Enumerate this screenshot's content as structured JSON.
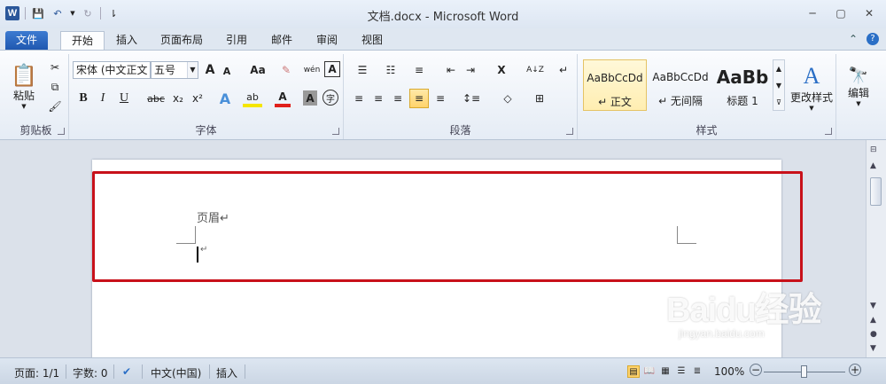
{
  "window": {
    "title": "文档.docx - Microsoft Word",
    "app_logo": "W",
    "controls": [
      "─",
      "▢",
      "✕"
    ]
  },
  "quick_access": {
    "save_icon": "💾",
    "undo_icon": "↶",
    "redo_icon": "↻",
    "customize_icon": "⇂"
  },
  "tabs": {
    "file": "文件",
    "items": [
      "开始",
      "插入",
      "页面布局",
      "引用",
      "邮件",
      "审阅",
      "视图"
    ],
    "active": "开始",
    "right_icons": [
      "⌃",
      "?"
    ]
  },
  "ribbon": {
    "clipboard": {
      "label": "剪贴板",
      "paste": "粘贴",
      "paste_icon": "📋",
      "cut_icon": "✂",
      "copy_icon": "⧉",
      "format_painter_icon": "🖌"
    },
    "font": {
      "label": "字体",
      "font_name": "宋体 (中文正文",
      "font_size": "五号",
      "grow": "A",
      "shrink": "A",
      "change_case": "Aa",
      "clear_format": "✎",
      "phonetic": "wén",
      "border_char": "A",
      "bold": "B",
      "italic": "I",
      "underline": "U",
      "strike": "abc",
      "subscript": "x₂",
      "superscript": "x²",
      "effects": "A",
      "highlight": "ab",
      "font_color": "A",
      "shading": "A",
      "enclose": "字",
      "colors": {
        "font_color": "#e0201b",
        "highlight": "#f5e600",
        "effects": "#4a90d9"
      }
    },
    "paragraph": {
      "label": "段落",
      "bullets": "☰",
      "numbering": "☷",
      "multilevel": "≡",
      "decrease_indent": "⇤",
      "increase_indent": "⇥",
      "chinese_layout": "X",
      "sort": "A↓Z",
      "show_marks": "↵",
      "align_left": "≡",
      "center": "≡",
      "align_right": "≡",
      "justify": "≡",
      "distributed": "≡",
      "line_spacing": "↕≡",
      "shading": "◇",
      "borders": "⊞"
    },
    "styles": {
      "label": "样式",
      "items": [
        {
          "sample": "AaBbCcDd",
          "name": "↵ 正文"
        },
        {
          "sample": "AaBbCcDd",
          "name": "↵ 无间隔"
        },
        {
          "sample": "AaBb",
          "name": "标题 1"
        }
      ],
      "change_styles": "更改样式",
      "change_styles_icon": "A"
    },
    "editing": {
      "label": "编辑",
      "icon": "🔭"
    }
  },
  "document": {
    "header_label": "页眉↵",
    "paragraph_mark": "↵",
    "highlight_color": "#c8111a"
  },
  "status": {
    "page": "页面: 1/1",
    "words": "字数: 0",
    "spell_icon": "✔",
    "language": "中文(中国)",
    "mode": "插入",
    "zoom": "100%",
    "zoom_out": "−",
    "zoom_in": "+",
    "view_icons": [
      "▤",
      "📖",
      "▦",
      "☰",
      "≣"
    ]
  },
  "watermark": {
    "brand": "Baidu经验",
    "url": "jingyan.baidu.com"
  }
}
